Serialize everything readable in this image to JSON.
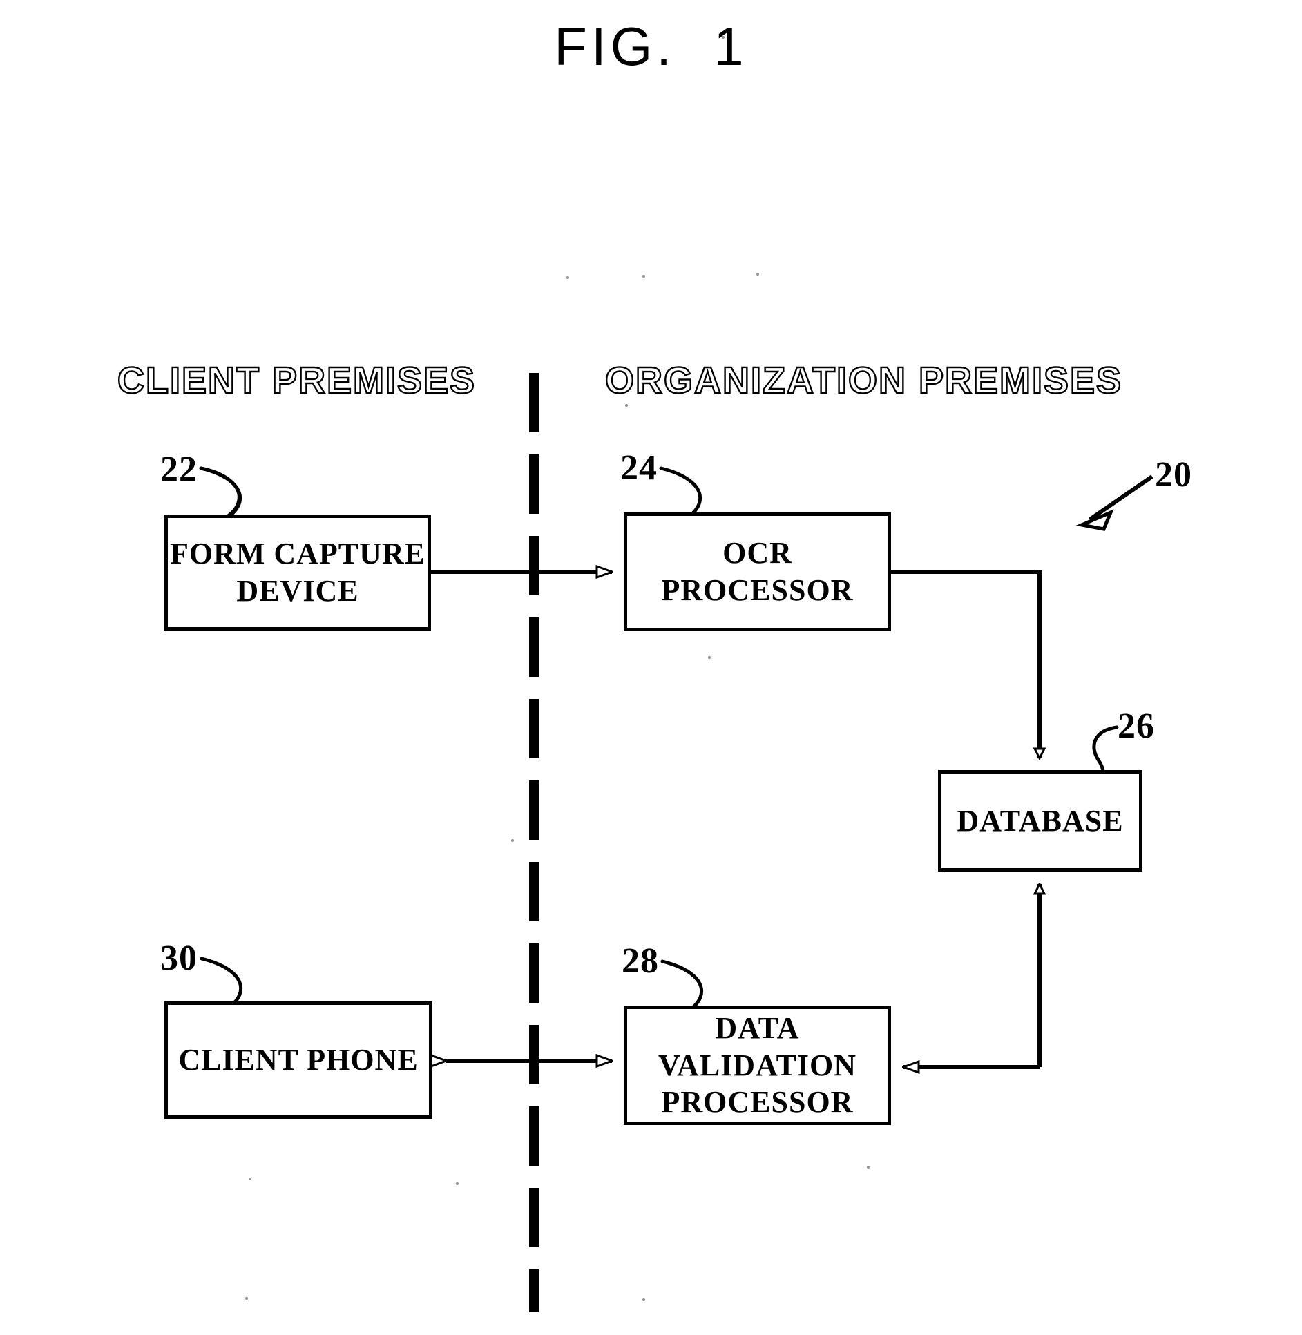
{
  "figure": {
    "title": "FIG.  1",
    "system_ref": "20"
  },
  "premises": {
    "client": "CLIENT PREMISES",
    "organization": "ORGANIZATION PREMISES"
  },
  "blocks": [
    {
      "id": "form-capture",
      "label": "FORM  CAPTURE\nDEVICE",
      "ref": "22",
      "side": "client"
    },
    {
      "id": "ocr",
      "label": "OCR\nPROCESSOR",
      "ref": "24",
      "side": "organization"
    },
    {
      "id": "database",
      "label": "DATABASE",
      "ref": "26",
      "side": "organization"
    },
    {
      "id": "client-phone",
      "label": "CLIENT  PHONE",
      "ref": "30",
      "side": "client"
    },
    {
      "id": "validation",
      "label": "DATA  VALIDATION\nPROCESSOR",
      "ref": "28",
      "side": "organization"
    }
  ],
  "connections": [
    {
      "from": "form-capture",
      "to": "ocr",
      "direction": "one-way"
    },
    {
      "from": "ocr",
      "to": "database",
      "direction": "one-way"
    },
    {
      "from": "database",
      "to": "validation",
      "direction": "one-way"
    },
    {
      "from": "validation",
      "to": "database",
      "direction": "one-way"
    },
    {
      "from": "client-phone",
      "to": "validation",
      "direction": "two-way"
    }
  ],
  "style": {
    "line_color": "#000000",
    "background": "#ffffff"
  }
}
